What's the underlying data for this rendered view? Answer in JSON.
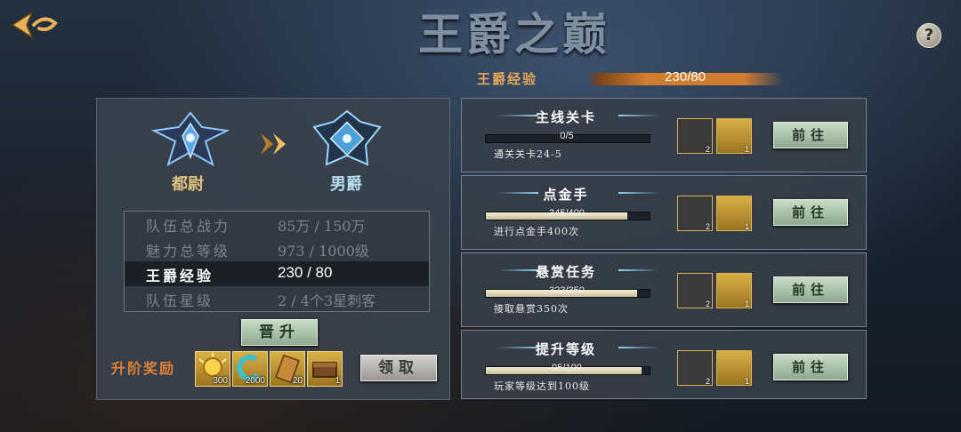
{
  "header": {
    "title": "王爵之巅",
    "back_icon": "back-arrow-icon",
    "help_label": "?"
  },
  "rank_progress": {
    "label": "王爵经验",
    "value_text": "230/80"
  },
  "promotion": {
    "current_rank": "都尉",
    "next_rank": "男爵",
    "arrow_icon": "double-chevron-right-icon",
    "stats": [
      {
        "name": "队伍总战力",
        "value": "85万 / 150万",
        "active": false
      },
      {
        "name": "魅力总等级",
        "value": "973 / 1000级",
        "active": false
      },
      {
        "name": "王爵经验",
        "value": "230 / 80",
        "active": true
      },
      {
        "name": "队伍星级",
        "value": "2 / 4个3星刺客",
        "active": false
      }
    ],
    "promote_button": "晋升",
    "reward_label": "升阶奖励",
    "rewards": [
      {
        "icon": "gold-coin-icon",
        "count": "300"
      },
      {
        "icon": "gem-icon",
        "count": "2000"
      },
      {
        "icon": "scroll-icon",
        "count": "20"
      },
      {
        "icon": "chest-icon",
        "count": "1"
      }
    ],
    "claim_button": "领取"
  },
  "tasks": [
    {
      "title": "主线关卡",
      "progress_text": "0/5",
      "progress": 0.0,
      "desc": "通关关卡24-5",
      "reward_counts": [
        "2",
        "1"
      ],
      "go_label": "前往"
    },
    {
      "title": "点金手",
      "progress_text": "345/400",
      "progress": 0.8625,
      "desc": "进行点金手400次",
      "reward_counts": [
        "2",
        "1"
      ],
      "go_label": "前往"
    },
    {
      "title": "悬赏任务",
      "progress_text": "323/350",
      "progress": 0.923,
      "desc": "接取悬赏350次",
      "reward_counts": [
        "2",
        "1"
      ],
      "go_label": "前往"
    },
    {
      "title": "提升等级",
      "progress_text": "95/100",
      "progress": 0.95,
      "desc": "玩家等级达到100级",
      "reward_counts": [
        "2",
        "1"
      ],
      "go_label": "前往"
    }
  ],
  "colors": {
    "accent_orange": "#e0813a",
    "gold": "#d9b047",
    "button_green": "#a9c0a8"
  }
}
